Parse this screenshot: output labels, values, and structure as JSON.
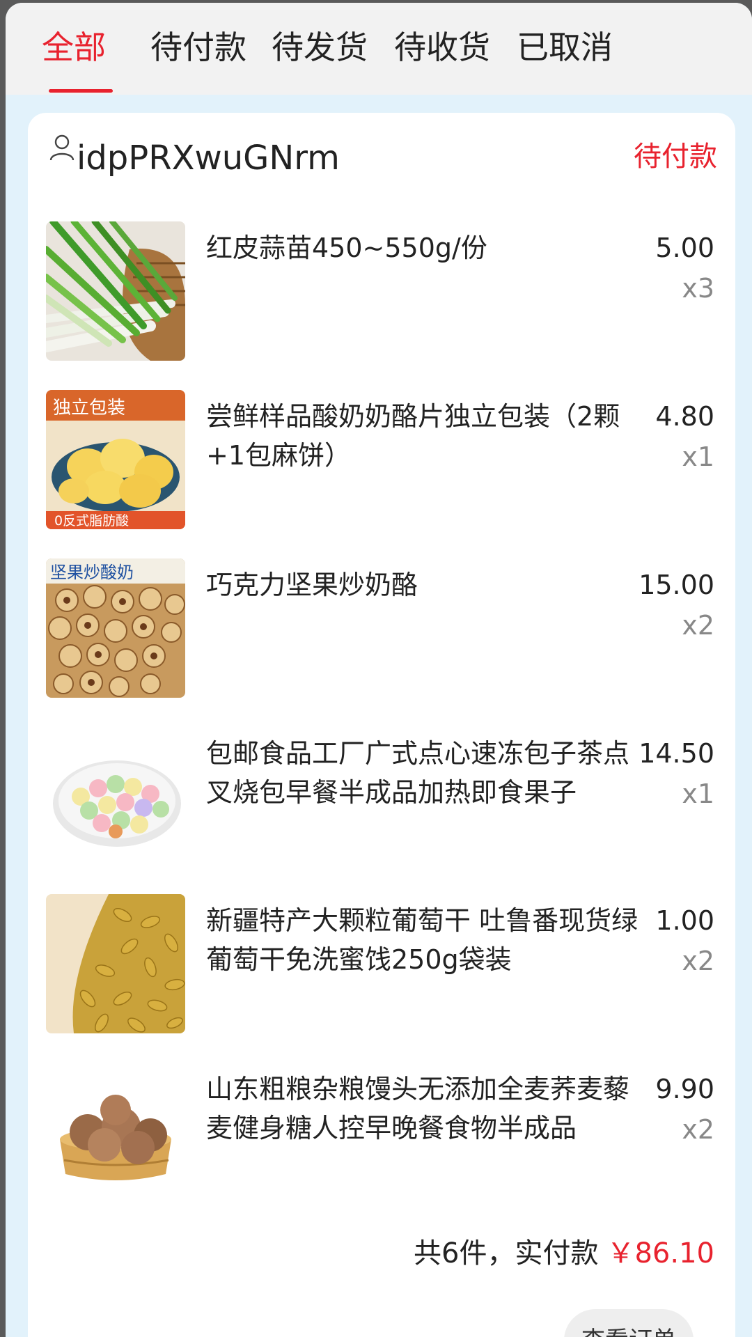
{
  "tabs": [
    {
      "label": "全部",
      "active": true
    },
    {
      "label": "待付款",
      "active": false
    },
    {
      "label": "待发货",
      "active": false
    },
    {
      "label": "待收货",
      "active": false
    },
    {
      "label": "已取消",
      "active": false
    }
  ],
  "order": {
    "user_icon": "user-icon",
    "username": "idpPRXwuGNrm",
    "status": "待付款",
    "items": [
      {
        "title": "红皮蒜苗450~550g/份",
        "price": "5.00",
        "qty": "x3"
      },
      {
        "title": "尝鲜样品酸奶奶酪片独立包装（2颗+1包麻饼）",
        "price": "4.80",
        "qty": "x1",
        "thumb_label_top": "独立包装",
        "thumb_label_bottom": "0反式脂肪酸"
      },
      {
        "title": "巧克力坚果炒奶酪",
        "price": "15.00",
        "qty": "x2",
        "thumb_label_top": "坚果炒酸奶"
      },
      {
        "title": "包邮食品工厂广式点心速冻包子茶点叉烧包早餐半成品加热即食果子",
        "price": "14.50",
        "qty": "x1"
      },
      {
        "title": "新疆特产大颗粒葡萄干 吐鲁番现货绿葡萄干免洗蜜饯250g袋装",
        "price": "1.00",
        "qty": "x2"
      },
      {
        "title": "山东粗粮杂粮馒头无添加全麦荞麦藜麦健身糖人控早晚餐食物半成品",
        "price": "9.90",
        "qty": "x2"
      }
    ],
    "summary_text": "共6件，实付款",
    "total": "￥86.10",
    "view_button": "查看订单"
  },
  "colors": {
    "accent": "#e8222e",
    "page_bg": "#e2f2fb"
  }
}
